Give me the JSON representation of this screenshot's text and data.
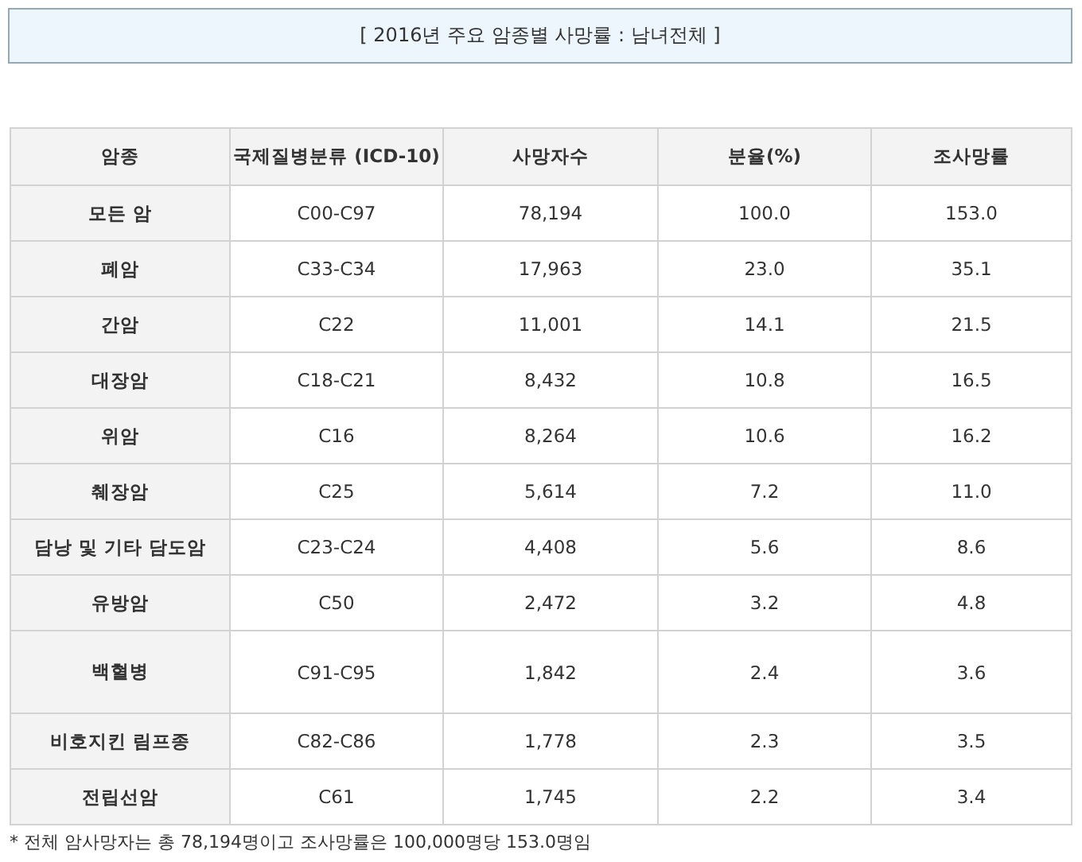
{
  "title": "[ 2016년 주요 암종별 사망률 : 남녀전체 ]",
  "table": {
    "columns": [
      "암종",
      "국제질병분류 (ICD-10)",
      "사망자수",
      "분율(%)",
      "조사망률"
    ],
    "rows": [
      [
        "모든 암",
        "C00-C97",
        "78,194",
        "100.0",
        "153.0"
      ],
      [
        "폐암",
        "C33-C34",
        "17,963",
        "23.0",
        "35.1"
      ],
      [
        "간암",
        "C22",
        "11,001",
        "14.1",
        "21.5"
      ],
      [
        "대장암",
        "C18-C21",
        "8,432",
        "10.8",
        "16.5"
      ],
      [
        "위암",
        "C16",
        "8,264",
        "10.6",
        "16.2"
      ],
      [
        "췌장암",
        "C25",
        "5,614",
        "7.2",
        "11.0"
      ],
      [
        "담낭 및 기타 담도암",
        "C23-C24",
        "4,408",
        "5.6",
        "8.6"
      ],
      [
        "유방암",
        "C50",
        "2,472",
        "3.2",
        "4.8"
      ],
      [
        "백혈병",
        "C91-C95",
        "1,842",
        "2.4",
        "3.6"
      ],
      [
        "비호지킨 림프종",
        "C82-C86",
        "1,778",
        "2.3",
        "3.5"
      ],
      [
        "전립선암",
        "C61",
        "1,745",
        "2.2",
        "3.4"
      ]
    ]
  },
  "footnote": "* 전체 암사망자는 총 78,194명이고 조사망률은 100,000명당 153.0명임"
}
